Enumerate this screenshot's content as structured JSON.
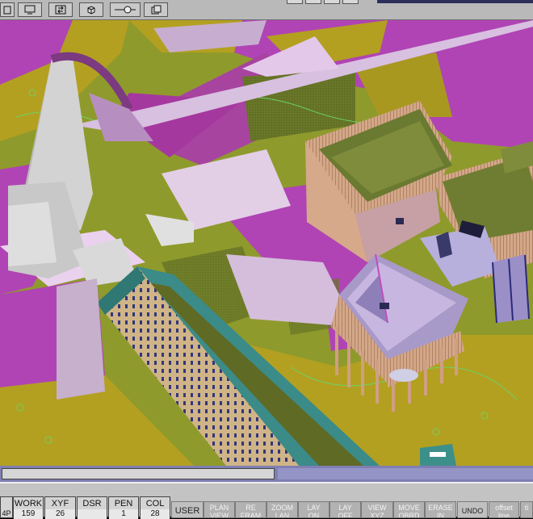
{
  "top_toolbar": {
    "buttons": [
      {
        "icon": "page-icon"
      },
      {
        "icon": "monitor-icon"
      },
      {
        "icon": "swap-icon"
      },
      {
        "icon": "cube-icon"
      },
      {
        "icon": "slider-icon"
      },
      {
        "icon": "copy-icon"
      }
    ]
  },
  "status_fields": [
    {
      "label": "WORK",
      "value": "159"
    },
    {
      "label": "XYF",
      "value": "26"
    },
    {
      "label": "DSR",
      "value": ""
    },
    {
      "label": "PEN",
      "value": "1"
    },
    {
      "label": "COL",
      "value": "28"
    }
  ],
  "left_tab": {
    "label": "4P"
  },
  "commands": [
    {
      "l1": "USER",
      "l2": ""
    },
    {
      "l1": "PLAN",
      "l2": "VIEW"
    },
    {
      "l1": "RE",
      "l2": "FRAM"
    },
    {
      "l1": "ZOOM",
      "l2": "LAN"
    },
    {
      "l1": "LAY",
      "l2": "ON"
    },
    {
      "l1": "LAY",
      "l2": "OFF"
    },
    {
      "l1": "VIEW",
      "l2": "XYZ"
    },
    {
      "l1": "MOVE",
      "l2": "OBRD"
    },
    {
      "l1": "ERASE",
      "l2": "IN"
    },
    {
      "l1": "UNDO",
      "l2": ""
    },
    {
      "l1": "offset",
      "l2": "line"
    },
    {
      "l1": "ti",
      "l2": ""
    }
  ],
  "colors": {
    "magenta": "#b044b4",
    "olive": "#8f9a2c",
    "mustard": "#b3a020",
    "pink_white": "#e7c8ec",
    "brick": "#c99a78",
    "teal": "#3d8f8a"
  }
}
